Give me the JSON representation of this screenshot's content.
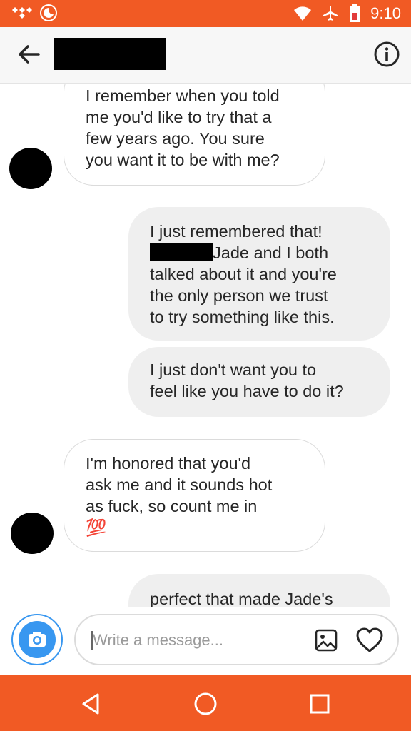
{
  "status_bar": {
    "time": "9:10"
  },
  "header": {
    "back_icon": "arrow-left",
    "info_icon": "info-circle"
  },
  "messages": [
    {
      "direction": "incoming",
      "lines": [
        "I remember when you told",
        "me you'd like to try that a",
        "few years ago. You sure",
        "you want it to be with me?"
      ]
    },
    {
      "direction": "outgoing",
      "lines": [
        "I just remembered that!",
        "Jade and I both",
        "talked about it and you're",
        "the only person we trust",
        "to try something like this."
      ]
    },
    {
      "direction": "outgoing",
      "lines": [
        "I just don't want you to",
        "feel like you have to do it?"
      ]
    },
    {
      "direction": "incoming",
      "lines": [
        "I'm honored that you'd",
        "ask me and it sounds hot",
        "as fuck, so count me in"
      ],
      "emoji": "💯"
    },
    {
      "direction": "outgoing",
      "lines": [
        "perfect that made Jade's"
      ]
    }
  ],
  "composer": {
    "placeholder": "Write a message..."
  },
  "colors": {
    "accent": "#f15a24",
    "link_blue": "#3897f0",
    "bubble_out": "#efefef"
  }
}
